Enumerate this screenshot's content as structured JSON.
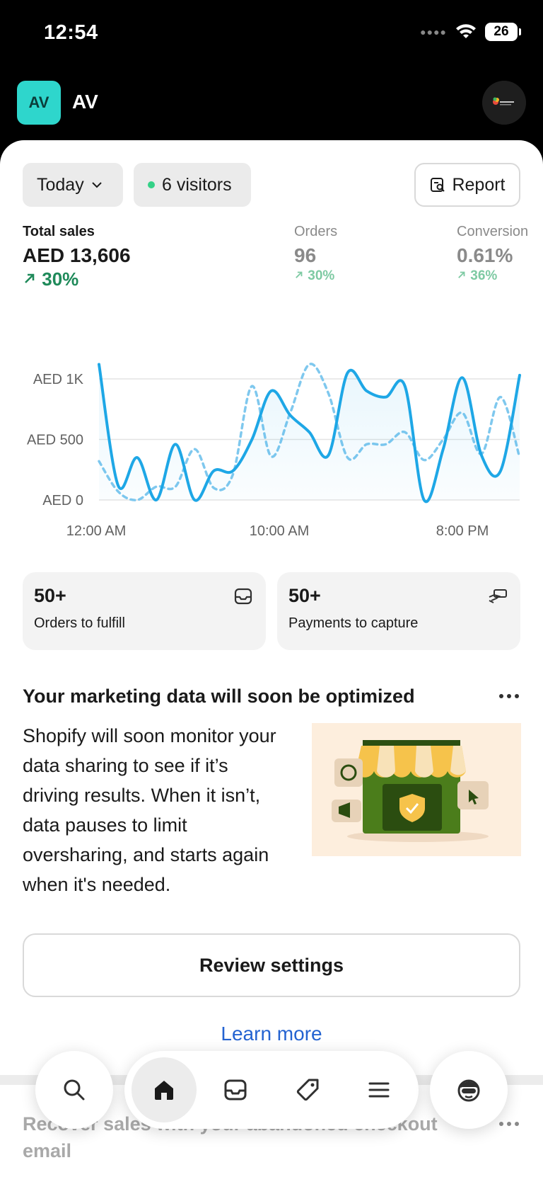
{
  "status_bar": {
    "time": "12:54",
    "battery": "26"
  },
  "header": {
    "store_initials": "AV",
    "store_name": "AV"
  },
  "filters": {
    "date_range": "Today",
    "visitors": "6 visitors",
    "report_label": "Report"
  },
  "metrics": [
    {
      "label": "Total sales",
      "value": "AED 13,606",
      "change": "30%"
    },
    {
      "label": "Orders",
      "value": "96",
      "change": "30%"
    },
    {
      "label": "Conversion",
      "value": "0.61%",
      "change": "36%"
    }
  ],
  "chart_data": {
    "type": "line",
    "x_tick_labels": [
      "12:00 AM",
      "10:00 AM",
      "8:00 PM"
    ],
    "y_tick_labels": [
      "AED 1K",
      "AED 500",
      "AED 0"
    ],
    "ylim": [
      0,
      1000
    ],
    "series": [
      {
        "style": "solid",
        "color": "#1ea7e6",
        "values": [
          1120,
          120,
          350,
          0,
          460,
          0,
          240,
          240,
          500,
          900,
          700,
          560,
          370,
          1050,
          900,
          850,
          940,
          0,
          420,
          1010,
          370,
          240,
          1030
        ]
      },
      {
        "style": "dashed",
        "color": "#7fc8ee",
        "values": [
          320,
          70,
          0,
          110,
          110,
          420,
          100,
          210,
          940,
          360,
          720,
          1120,
          880,
          350,
          460,
          460,
          560,
          330,
          500,
          720,
          380,
          850,
          350
        ]
      }
    ],
    "grid": true
  },
  "tiles": [
    {
      "count": "50+",
      "label": "Orders to fulfill",
      "icon": "inbox-icon"
    },
    {
      "count": "50+",
      "label": "Payments to capture",
      "icon": "cash-hand-icon"
    }
  ],
  "marketing": {
    "title": "Your marketing data will soon be optimized",
    "body": "Shopify will soon monitor your data sharing to see if it’s driving results. When it isn’t, data pauses to limit oversharing, and starts again when it's needed.",
    "primary_action": "Review settings",
    "secondary_action": "Learn more"
  },
  "next_card": {
    "title": "Recover sales with your abandoned checkout email"
  },
  "nav": {
    "active": "home"
  },
  "colors": {
    "accent_green": "#1f8a5a",
    "link_blue": "#2463d1",
    "chart_blue": "#1ea7e6"
  }
}
